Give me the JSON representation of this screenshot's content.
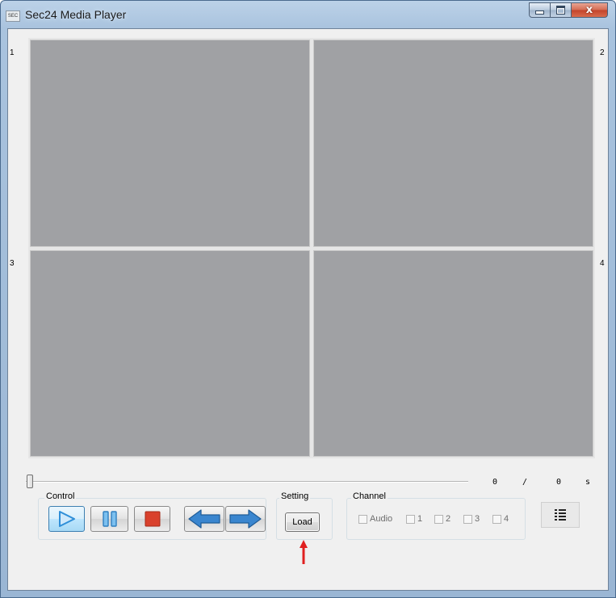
{
  "window": {
    "title": "Sec24 Media Player",
    "icon_text": "SEC",
    "close_glyph": "x"
  },
  "video_panels": [
    {
      "label": "1"
    },
    {
      "label": "2"
    },
    {
      "label": "3"
    },
    {
      "label": "4"
    }
  ],
  "timeline": {
    "position": 0,
    "current": "0",
    "separator": "/",
    "total": "0",
    "unit": "s"
  },
  "control": {
    "label": "Control",
    "buttons": [
      "play-icon",
      "pause-icon",
      "stop-icon",
      "previous-arrow-icon",
      "next-arrow-icon"
    ]
  },
  "setting": {
    "label": "Setting",
    "load_label": "Load"
  },
  "channel": {
    "label": "Channel",
    "options": [
      {
        "label": "Audio",
        "checked": false
      },
      {
        "label": "1",
        "checked": false
      },
      {
        "label": "2",
        "checked": false
      },
      {
        "label": "3",
        "checked": false
      },
      {
        "label": "4",
        "checked": false
      }
    ]
  },
  "colors": {
    "video_bg": "#a0a1a4",
    "annotation_arrow": "#e02020",
    "play_blue": "#2f8fd8",
    "stop_red": "#d9412c"
  }
}
